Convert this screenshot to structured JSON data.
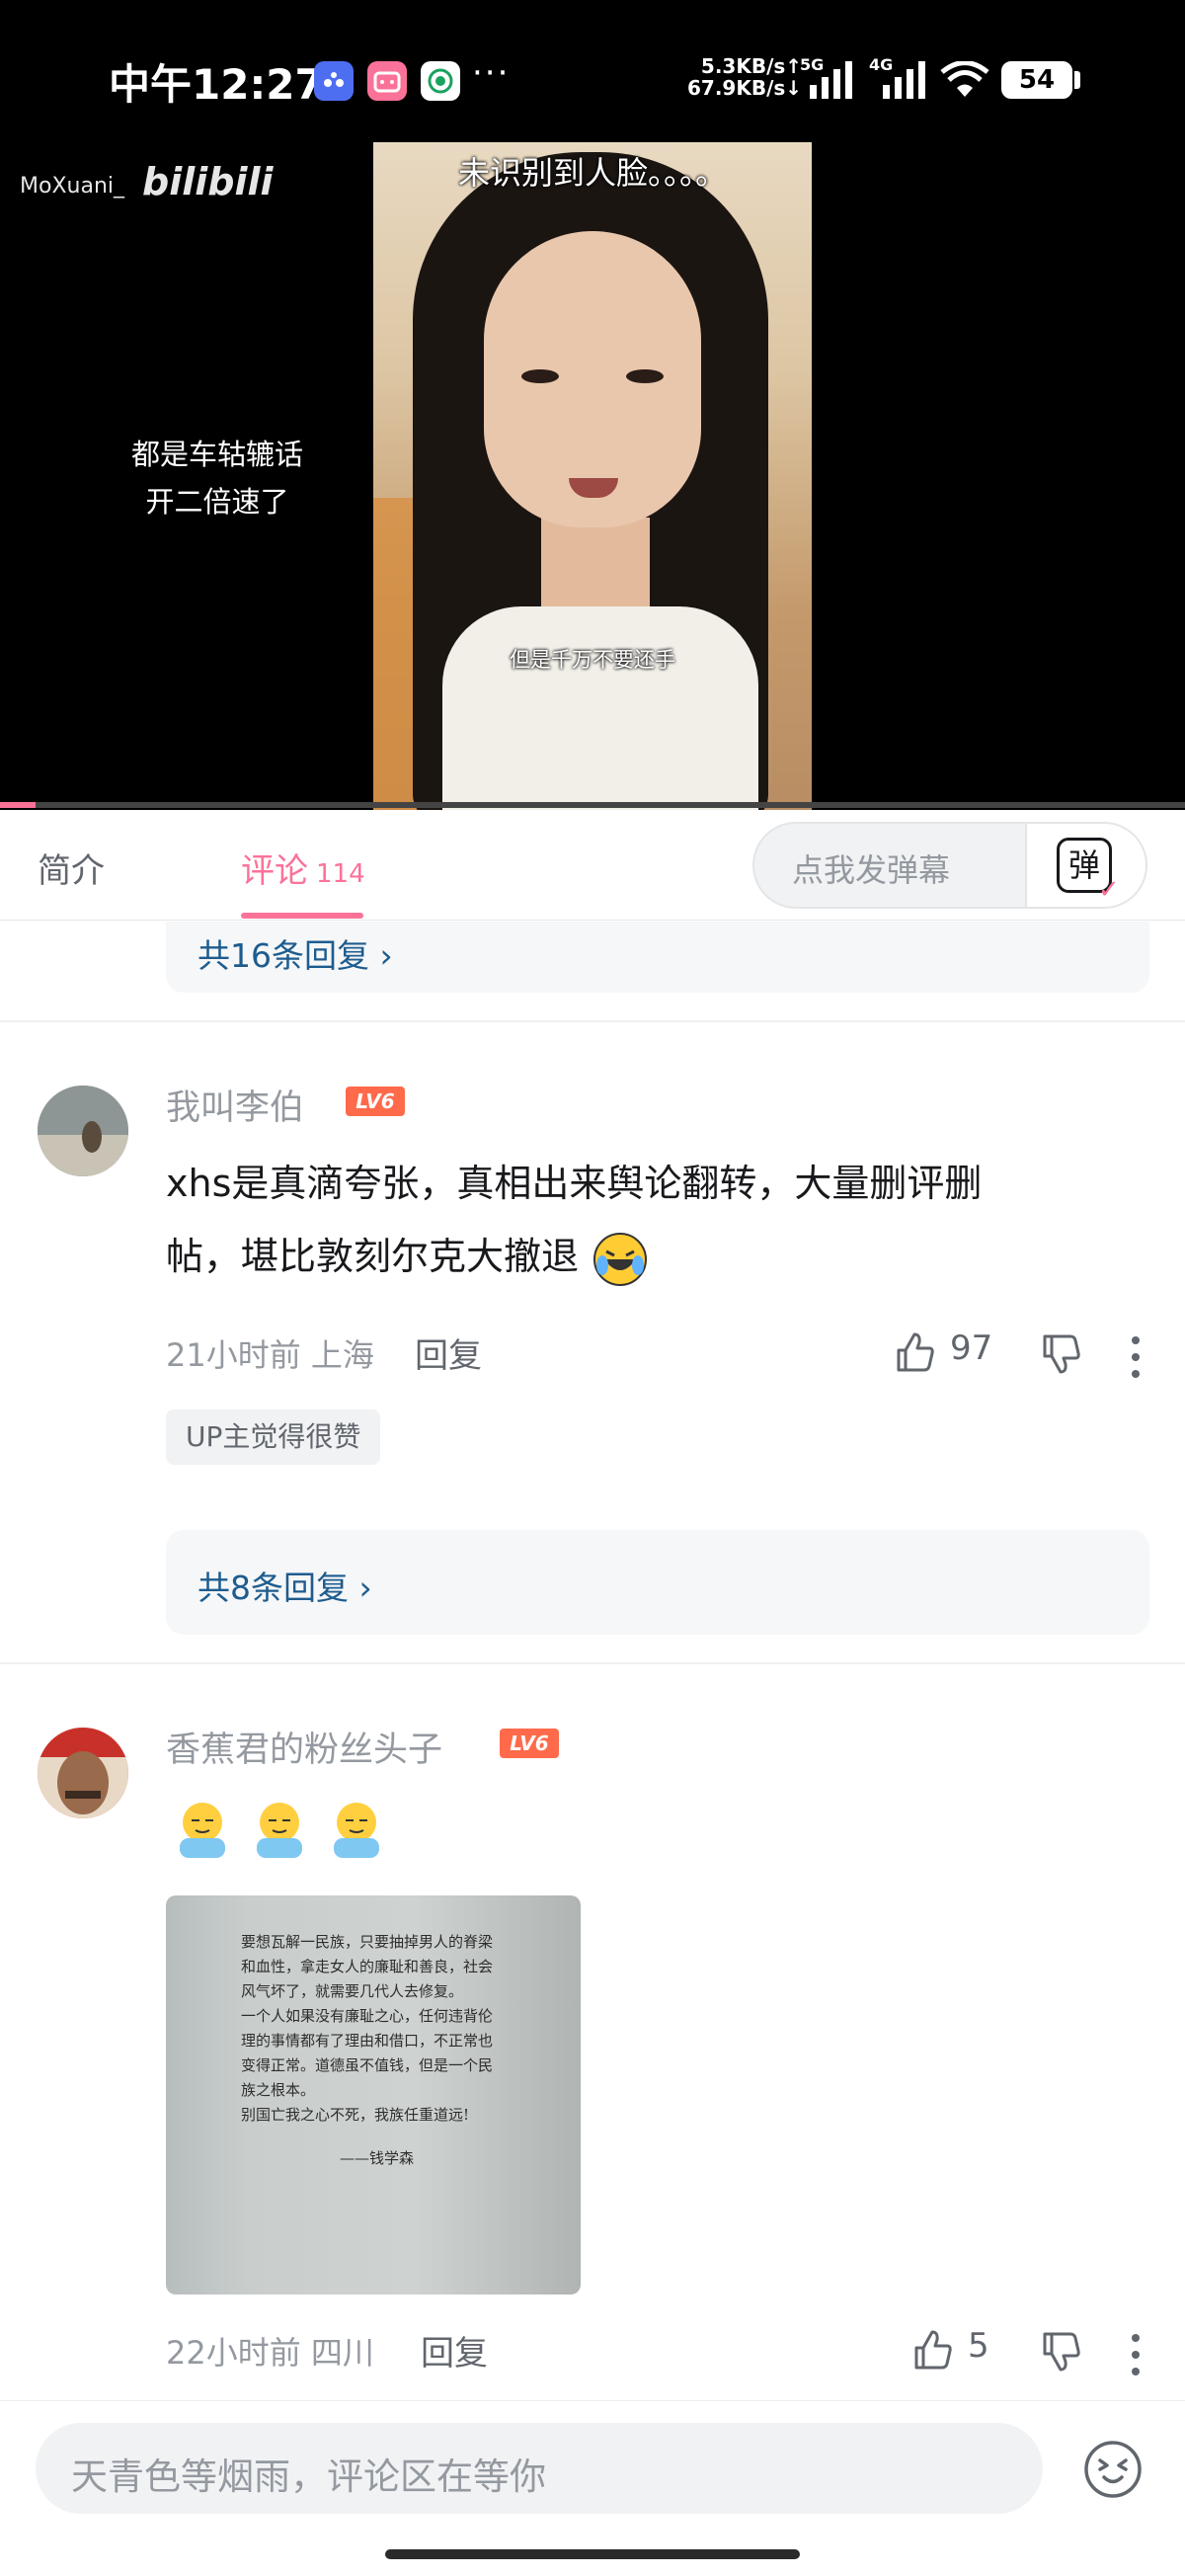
{
  "status_bar": {
    "time": "中午12:27",
    "app_icons": [
      "baidu-app-icon",
      "bilibili-app-icon",
      "unicom-app-icon"
    ],
    "overflow": "···",
    "net_up": "5.3KB/s↑",
    "net_down": "67.9KB/s↓",
    "net_type_1": "5G",
    "net_type_2": "4G",
    "battery": "54"
  },
  "video": {
    "watermark_user": "MoXuani_",
    "watermark_logo": "bilibili",
    "top_caption": "未识别到人脸。。。。",
    "subtitle": "但是千万不要还手",
    "side_caption_line1": "都是车轱辘话",
    "side_caption_line2": "开二倍速了",
    "progress_fraction": 0.03,
    "accent": "#fb7299"
  },
  "tabs": {
    "intro": "简介",
    "comments": "评论",
    "comments_count": "114",
    "danmaku_placeholder": "点我发弹幕",
    "danmaku_glyph": "弹"
  },
  "comments": {
    "top_reply_link": "共16条回复",
    "items": [
      {
        "username": "我叫李伯",
        "level": "LV6",
        "text_line1": "xhs是真滴夸张，真相出来舆论翻转，大量删评删",
        "text_line2": "帖，堪比敦刻尔克大撤退",
        "time_loc": "21小时前 上海",
        "reply": "回复",
        "likes": "97",
        "badge": "UP主觉得很赞",
        "reply_link": "共8条回复"
      },
      {
        "username": "香蕉君的粉丝头子",
        "level": "LV6",
        "emojis": [
          "hug-emoji",
          "hug-emoji",
          "hug-emoji"
        ],
        "image_text": [
          "要想瓦解一民族，只要抽掉男人的脊梁",
          "和血性，拿走女人的廉耻和善良，社会",
          "风气坏了，就需要几代人去修复。",
          "一个人如果没有廉耻之心，任何违背伦",
          "理的事情都有了理由和借口，不正常也",
          "变得正常。道德虽不值钱，但是一个民",
          "族之根本。",
          "别国亡我之心不死，我族任重道远!",
          "——钱学森"
        ],
        "time_loc": "22小时前 四川",
        "reply": "回复",
        "likes": "5"
      }
    ]
  },
  "bottom": {
    "input_placeholder": "天青色等烟雨，评论区在等你"
  }
}
